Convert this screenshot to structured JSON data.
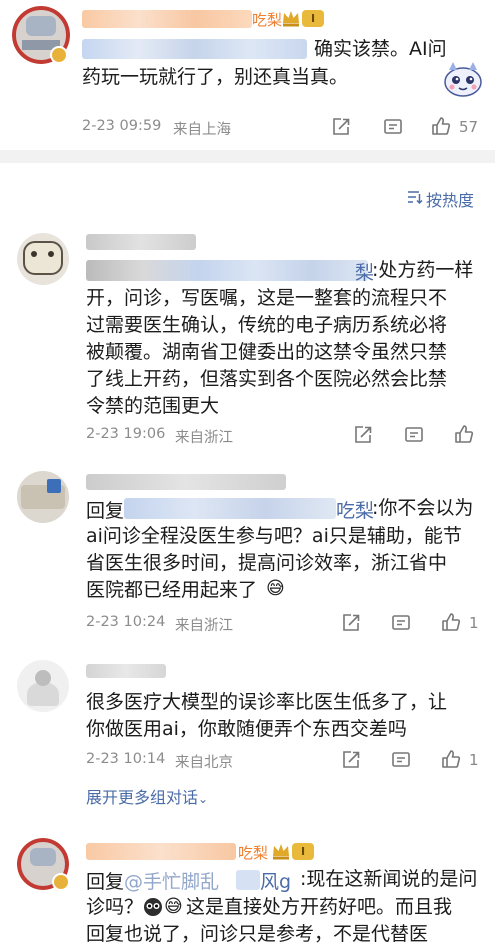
{
  "top_comment": {
    "username_suffix": "吃梨",
    "badge": "I",
    "text_line1": "确实该禁。AI问",
    "text_line2": "药玩一玩就行了，别还真当真。",
    "date": "2-23 09:59",
    "location": "来自上海",
    "like_count": "57"
  },
  "sort": {
    "label": "按热度"
  },
  "replies": [
    {
      "mention_suffix": "梨",
      "lines": [
        ":处方药一样",
        "开，问诊，写医嘱，这是一整套的流程只不",
        "过需要医生确认，传统的电子病历系统必将",
        "被颠覆。湖南省卫健委出的这禁令虽然只禁",
        "了线上开药，但落实到各个医院必然会比禁",
        "令禁的范围更大"
      ],
      "date": "2-23 19:06",
      "location": "来自浙江",
      "like_count": ""
    },
    {
      "prefix": "回复",
      "mention_suffix": "吃梨",
      "lines": [
        ":你不会以为",
        "ai问诊全程没医生参与吧？ai只是辅助，能节",
        "省医生很多时间，提高问诊效率，浙江省中",
        "医院都已经用起来了"
      ],
      "emoji": "😅",
      "date": "2-23 10:24",
      "location": "来自浙江",
      "like_count": "1"
    },
    {
      "lines": [
        "很多医疗大模型的误诊率比医生低多了，让",
        "你做医用ai，你敢随便弄个东西交差吗"
      ],
      "date": "2-23 10:14",
      "location": "来自北京",
      "like_count": "1"
    }
  ],
  "expand": {
    "label": "展开更多组对话"
  },
  "bottom_reply": {
    "nick_suffix": "吃梨",
    "badge": "I",
    "prefix": "回复",
    "mention": "@手忙脚乱",
    "mention_suffix": "风g",
    "line1_rest": ":现在这新闻说的是问",
    "line2_pre": "诊吗？",
    "line2_post": "这是直接处方开药好吧。而且我",
    "line3": "回复也说了，问诊只是参考，不是代替医"
  }
}
